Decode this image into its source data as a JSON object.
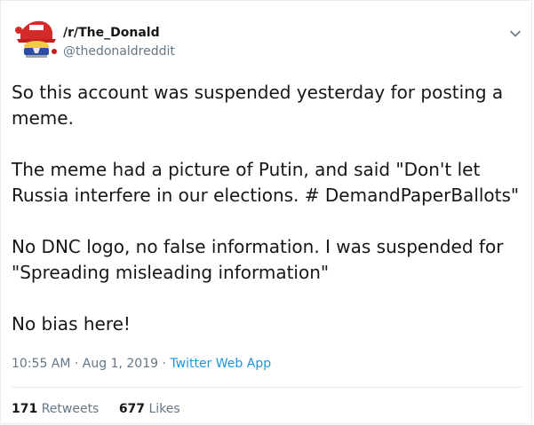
{
  "account": {
    "name": "/r/The_Donald",
    "handle": "@thedonaldreddit"
  },
  "tweet": {
    "paragraphs": [
      [
        "So this account was suspended yesterday for posting a",
        "meme."
      ],
      [
        "The meme had a picture of Putin, and said \"Don't let",
        "Russia interfere in our elections. # DemandPaperBallots\""
      ],
      [
        "No DNC logo, no false information. I was suspended for",
        "\"Spreading misleading information\""
      ],
      [
        "No bias here!"
      ]
    ],
    "timestamp": "10:55 AM · Aug 1, 2019",
    "separator": " · ",
    "source": "Twitter Web App"
  },
  "stats": {
    "retweets_count": "171",
    "retweets_label": "Retweets",
    "likes_count": "677",
    "likes_label": "Likes"
  },
  "icons": {
    "menu": "chevron-down-icon",
    "avatar": "trump-hat-avatar"
  },
  "colors": {
    "text": "#14171a",
    "secondary": "#657786",
    "link": "#1b95e0",
    "border": "#e6ecf0"
  }
}
